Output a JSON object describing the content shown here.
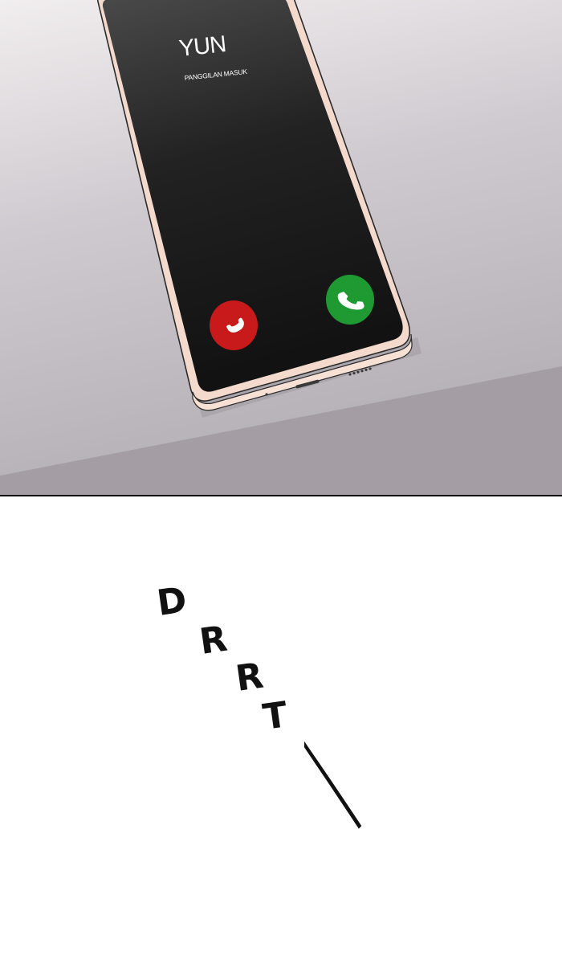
{
  "phone": {
    "caller_name": "YUN",
    "call_status": "PANGGILAN MASUK",
    "decline_icon": "phone-hangup-icon",
    "accept_icon": "phone-icon",
    "decline_color": "#c8191b",
    "accept_color": "#1f9a33"
  },
  "sound_effect": {
    "letters": [
      "D",
      "R",
      "R",
      "T"
    ]
  },
  "colors": {
    "background_top": "#e9e6e8",
    "background_mid": "#bdb8be",
    "table_edge": "#a39da3",
    "screen": "#1b1b1b",
    "phone_frame": "#f4dccf"
  }
}
